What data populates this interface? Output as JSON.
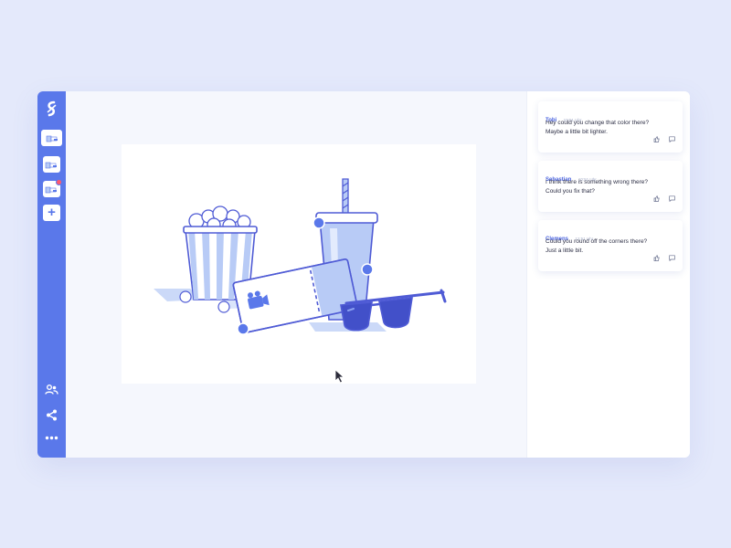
{
  "colors": {
    "page_background": "#e4e9fb",
    "sidebar": "#5a78ea",
    "accent": "#4a63e0",
    "illustration_light": "#b8cbf6",
    "illustration_stroke": "#4f5bd5",
    "notification": "#ff5a6e"
  },
  "sidebar": {
    "logo_icon": "squiggle-logo",
    "pages": [
      {
        "icon": "page-thumbnail",
        "active": true,
        "notification": false
      },
      {
        "icon": "page-thumbnail",
        "active": false,
        "notification": false
      },
      {
        "icon": "page-thumbnail",
        "active": false,
        "notification": true
      }
    ],
    "add_page_label": "+",
    "bottom_icons": [
      "users-icon",
      "share-icon",
      "more-icon"
    ]
  },
  "canvas": {
    "illustration": [
      "popcorn-bucket",
      "drink-cup-with-straw",
      "cinema-ticket",
      "sunglasses"
    ],
    "selection_handles": 3,
    "cursor_icon": "arrow-cursor"
  },
  "comments": [
    {
      "author": "Tobi",
      "time": "10:51 Uhr",
      "text": "Hey could you change that color there?\nMaybe a little bit lighter."
    },
    {
      "author": "Sebastian",
      "time": "10:51 Uhr",
      "text": "I think there is something wrong there?\nCould you fix that?"
    },
    {
      "author": "Clemens",
      "time": "12:51 Uhr",
      "text": "Could you round off the corners there?\nJust a little bit."
    }
  ]
}
